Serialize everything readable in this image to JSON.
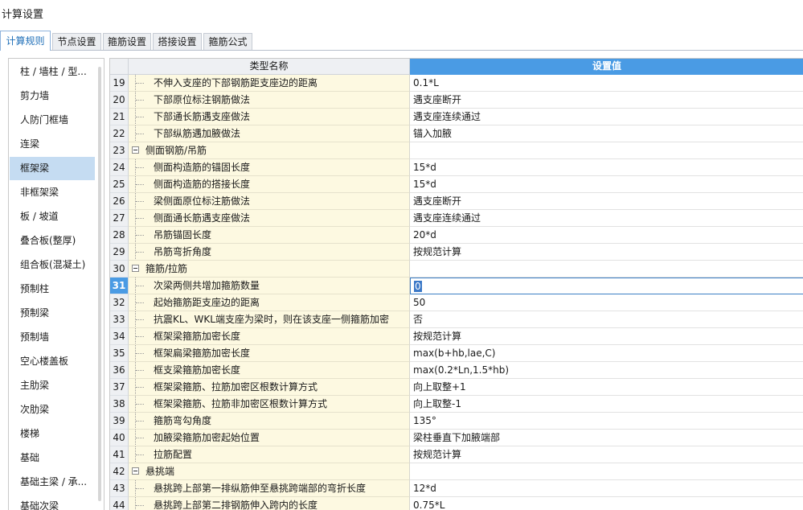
{
  "window": {
    "title": "计算设置"
  },
  "tabs": [
    {
      "label": "计算规则",
      "active": true
    },
    {
      "label": "节点设置",
      "active": false
    },
    {
      "label": "箍筋设置",
      "active": false
    },
    {
      "label": "搭接设置",
      "active": false
    },
    {
      "label": "箍筋公式",
      "active": false
    }
  ],
  "sidebar": {
    "items": [
      {
        "label": "柱 / 墙柱 / 型..."
      },
      {
        "label": "剪力墙"
      },
      {
        "label": "人防门框墙"
      },
      {
        "label": "连梁"
      },
      {
        "label": "框架梁",
        "active": true
      },
      {
        "label": "非框架梁"
      },
      {
        "label": "板 / 坡道"
      },
      {
        "label": "叠合板(整厚)"
      },
      {
        "label": "组合板(混凝土)"
      },
      {
        "label": "预制柱"
      },
      {
        "label": "预制梁"
      },
      {
        "label": "预制墙"
      },
      {
        "label": "空心楼盖板"
      },
      {
        "label": "主肋梁"
      },
      {
        "label": "次肋梁"
      },
      {
        "label": "楼梯"
      },
      {
        "label": "基础"
      },
      {
        "label": "基础主梁 / 承..."
      },
      {
        "label": "基础次梁"
      }
    ]
  },
  "grid": {
    "col_name": "类型名称",
    "col_value": "设置值",
    "rows": [
      {
        "num": "19",
        "name": "不伸入支座的下部钢筋距支座边的距离",
        "value": "0.1*L"
      },
      {
        "num": "20",
        "name": "下部原位标注钢筋做法",
        "value": "遇支座断开"
      },
      {
        "num": "21",
        "name": "下部通长筋遇支座做法",
        "value": "遇支座连续通过"
      },
      {
        "num": "22",
        "name": "下部纵筋遇加腋做法",
        "value": "锚入加腋"
      },
      {
        "num": "23",
        "name": "侧面钢筋/吊筋",
        "value": "",
        "group": true
      },
      {
        "num": "24",
        "name": "侧面构造筋的锚固长度",
        "value": "15*d"
      },
      {
        "num": "25",
        "name": "侧面构造筋的搭接长度",
        "value": "15*d"
      },
      {
        "num": "26",
        "name": "梁侧面原位标注筋做法",
        "value": "遇支座断开"
      },
      {
        "num": "27",
        "name": "侧面通长筋遇支座做法",
        "value": "遇支座连续通过"
      },
      {
        "num": "28",
        "name": "吊筋锚固长度",
        "value": "20*d"
      },
      {
        "num": "29",
        "name": "吊筋弯折角度",
        "value": "按规范计算"
      },
      {
        "num": "30",
        "name": "箍筋/拉筋",
        "value": "",
        "group": true
      },
      {
        "num": "31",
        "name": "次梁两侧共增加箍筋数量",
        "value": "0",
        "selected": true
      },
      {
        "num": "32",
        "name": "起始箍筋距支座边的距离",
        "value": "50"
      },
      {
        "num": "33",
        "name": "抗震KL、WKL端支座为梁时，则在该支座一侧箍筋加密",
        "value": "否"
      },
      {
        "num": "34",
        "name": "框架梁箍筋加密长度",
        "value": "按规范计算"
      },
      {
        "num": "35",
        "name": "框架扁梁箍筋加密长度",
        "value": "max(b+hb,lae,C)"
      },
      {
        "num": "36",
        "name": "框支梁箍筋加密长度",
        "value": "max(0.2*Ln,1.5*hb)"
      },
      {
        "num": "37",
        "name": "框架梁箍筋、拉筋加密区根数计算方式",
        "value": "向上取整+1"
      },
      {
        "num": "38",
        "name": "框架梁箍筋、拉筋非加密区根数计算方式",
        "value": "向上取整-1"
      },
      {
        "num": "39",
        "name": "箍筋弯勾角度",
        "value": "135°"
      },
      {
        "num": "40",
        "name": "加腋梁箍筋加密起始位置",
        "value": "梁柱垂直下加腋端部"
      },
      {
        "num": "41",
        "name": "拉筋配置",
        "value": "按规范计算"
      },
      {
        "num": "42",
        "name": "悬挑端",
        "value": "",
        "group": true
      },
      {
        "num": "43",
        "name": "悬挑跨上部第一排纵筋伸至悬挑跨端部的弯折长度",
        "value": "12*d"
      },
      {
        "num": "44",
        "name": "悬挑跨上部第二排钢筋伸入跨内的长度",
        "value": "0.75*L"
      }
    ]
  }
}
